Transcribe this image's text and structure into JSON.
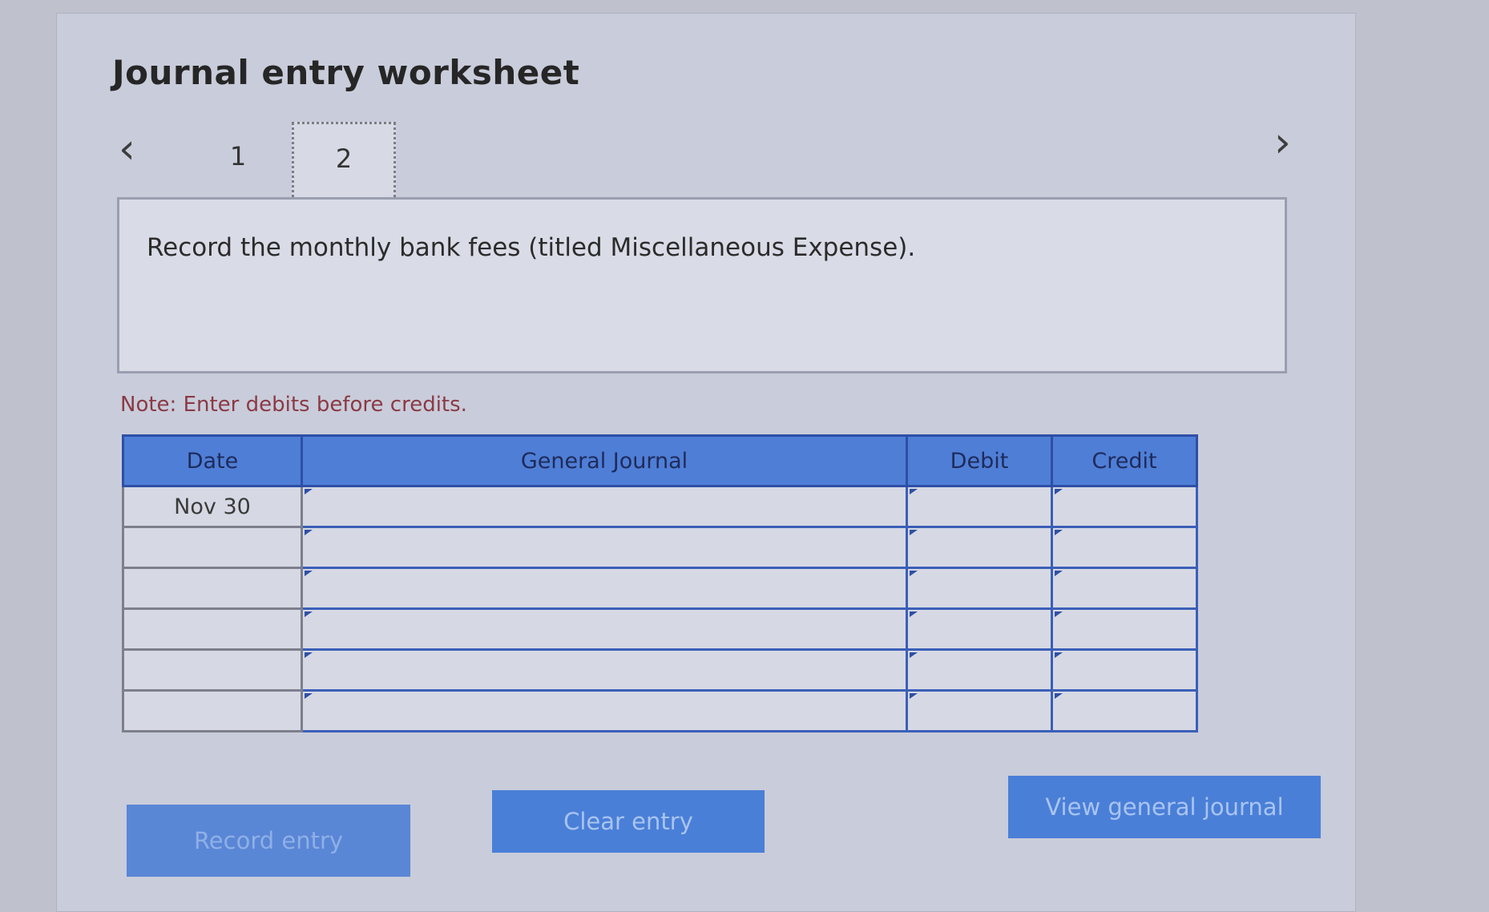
{
  "worksheet": {
    "title": "Journal entry worksheet",
    "nav": {
      "prev_icon": "‹",
      "next_icon": "›"
    },
    "tabs": [
      {
        "label": "1"
      },
      {
        "label": "2",
        "active": true
      }
    ],
    "instruction": "Record the monthly bank fees (titled Miscellaneous Expense).",
    "note": "Note: Enter debits before credits."
  },
  "table": {
    "headers": {
      "date": "Date",
      "journal": "General Journal",
      "debit": "Debit",
      "credit": "Credit"
    },
    "rows": [
      {
        "date": "Nov 30",
        "journal": "",
        "debit": "",
        "credit": ""
      },
      {
        "date": "",
        "journal": "",
        "debit": "",
        "credit": ""
      },
      {
        "date": "",
        "journal": "",
        "debit": "",
        "credit": ""
      },
      {
        "date": "",
        "journal": "",
        "debit": "",
        "credit": ""
      },
      {
        "date": "",
        "journal": "",
        "debit": "",
        "credit": ""
      },
      {
        "date": "",
        "journal": "",
        "debit": "",
        "credit": ""
      }
    ]
  },
  "buttons": {
    "record": "Record entry",
    "clear": "Clear entry",
    "view": "View general journal"
  },
  "colors": {
    "header_blue": "#4f7ed6",
    "note_red": "#8a3a45",
    "button_blue": "#4a7fd8"
  }
}
